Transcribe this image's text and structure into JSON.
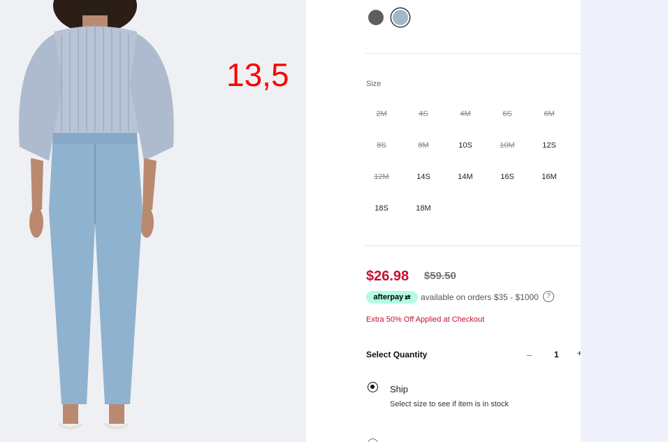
{
  "overlay_number": "13,5",
  "colors": {
    "sale_price": "#c8102e",
    "afterpay_badge": "#b2fce4",
    "swatch_dark": "#5e5e62",
    "swatch_light_blue": "#9fb8cc"
  },
  "product": {
    "size_label": "Size",
    "sizes": [
      {
        "label": "2M",
        "available": false
      },
      {
        "label": "4S",
        "available": false
      },
      {
        "label": "4M",
        "available": false
      },
      {
        "label": "6S",
        "available": false
      },
      {
        "label": "6M",
        "available": false
      },
      {
        "label": "8S",
        "available": false
      },
      {
        "label": "8M",
        "available": false
      },
      {
        "label": "10S",
        "available": true
      },
      {
        "label": "10M",
        "available": false
      },
      {
        "label": "12S",
        "available": true
      },
      {
        "label": "12M",
        "available": false
      },
      {
        "label": "14S",
        "available": true
      },
      {
        "label": "14M",
        "available": true
      },
      {
        "label": "16S",
        "available": true
      },
      {
        "label": "16M",
        "available": true
      },
      {
        "label": "18S",
        "available": true
      },
      {
        "label": "18M",
        "available": true
      }
    ],
    "price_sale": "$26.98",
    "price_original": "$59.50",
    "afterpay_label": "afterpay",
    "afterpay_text": "available on orders $35 - $1000",
    "help_icon": "?",
    "promo_text": "Extra 50% Off Applied at Checkout",
    "quantity_label": "Select Quantity",
    "quantity_value": "1",
    "quantity_minus": "–",
    "quantity_plus": "+",
    "ship_label": "Ship",
    "ship_sub": "Select size to see if item is in stock"
  }
}
